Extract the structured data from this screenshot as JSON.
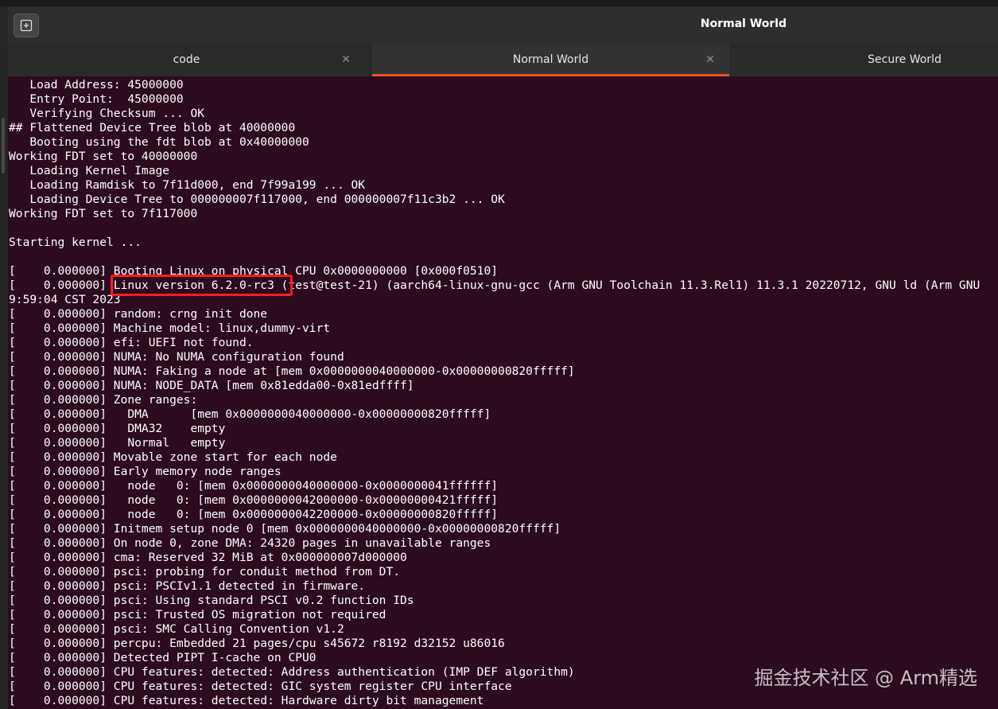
{
  "window": {
    "title": "Normal World"
  },
  "tabs": [
    {
      "label": "code",
      "close_icon": "close-icon",
      "active": false
    },
    {
      "label": "Normal World",
      "close_icon": "close-icon",
      "active": true
    },
    {
      "label": "Secure World",
      "active": false
    }
  ],
  "terminal": {
    "lines": [
      "   Load Address: 45000000",
      "   Entry Point:  45000000",
      "   Verifying Checksum ... OK",
      "## Flattened Device Tree blob at 40000000",
      "   Booting using the fdt blob at 0x40000000",
      "Working FDT set to 40000000",
      "   Loading Kernel Image",
      "   Loading Ramdisk to 7f11d000, end 7f99a199 ... OK",
      "   Loading Device Tree to 000000007f117000, end 000000007f11c3b2 ... OK",
      "Working FDT set to 7f117000",
      "",
      "Starting kernel ...",
      "",
      "[    0.000000] Booting Linux on physical CPU 0x0000000000 [0x000f0510]",
      "[    0.000000] Linux version 6.2.0-rc3 (test@test-21) (aarch64-linux-gnu-gcc (Arm GNU Toolchain 11.3.Rel1) 11.3.1 20220712, GNU ld (Arm GNU",
      "9:59:04 CST 2023",
      "[    0.000000] random: crng init done",
      "[    0.000000] Machine model: linux,dummy-virt",
      "[    0.000000] efi: UEFI not found.",
      "[    0.000000] NUMA: No NUMA configuration found",
      "[    0.000000] NUMA: Faking a node at [mem 0x0000000040000000-0x00000000820fffff]",
      "[    0.000000] NUMA: NODE_DATA [mem 0x81edda00-0x81edffff]",
      "[    0.000000] Zone ranges:",
      "[    0.000000]   DMA      [mem 0x0000000040000000-0x00000000820fffff]",
      "[    0.000000]   DMA32    empty",
      "[    0.000000]   Normal   empty",
      "[    0.000000] Movable zone start for each node",
      "[    0.000000] Early memory node ranges",
      "[    0.000000]   node   0: [mem 0x0000000040000000-0x0000000041ffffff]",
      "[    0.000000]   node   0: [mem 0x0000000042000000-0x00000000421fffff]",
      "[    0.000000]   node   0: [mem 0x0000000042200000-0x00000000820fffff]",
      "[    0.000000] Initmem setup node 0 [mem 0x0000000040000000-0x00000000820fffff]",
      "[    0.000000] On node 0, zone DMA: 24320 pages in unavailable ranges",
      "[    0.000000] cma: Reserved 32 MiB at 0x000000007d000000",
      "[    0.000000] psci: probing for conduit method from DT.",
      "[    0.000000] psci: PSCIv1.1 detected in firmware.",
      "[    0.000000] psci: Using standard PSCI v0.2 function IDs",
      "[    0.000000] psci: Trusted OS migration not required",
      "[    0.000000] psci: SMC Calling Convention v1.2",
      "[    0.000000] percpu: Embedded 21 pages/cpu s45672 r8192 d32152 u86016",
      "[    0.000000] Detected PIPT I-cache on CPU0",
      "[    0.000000] CPU features: detected: Address authentication (IMP DEF algorithm)",
      "[    0.000000] CPU features: detected: GIC system register CPU interface",
      "[    0.000000] CPU features: detected: Hardware dirty bit management"
    ]
  },
  "watermark": {
    "text": "掘金技术社区 @ Arm精选"
  },
  "colors": {
    "terminal_bg": "#2c0a1f",
    "terminal_fg": "#ffffff",
    "tab_accent": "#e95420",
    "highlight": "#ff1e1e"
  }
}
